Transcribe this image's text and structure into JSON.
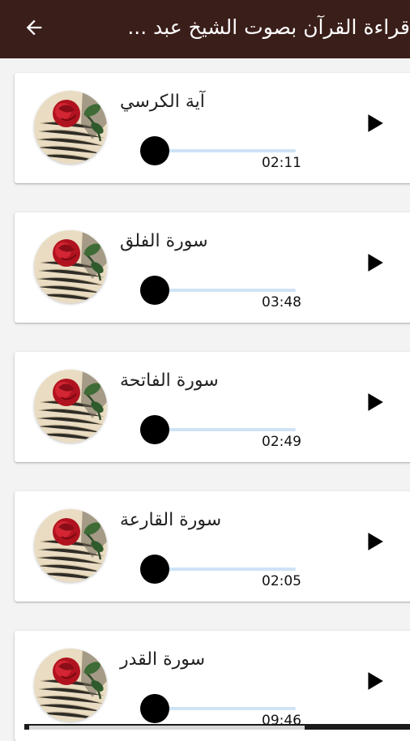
{
  "header": {
    "title": "قراءة القرآن بصوت الشيخ عبد ...",
    "back_icon": "arrow-left-icon",
    "background": "#3a1e19"
  },
  "tracks": [
    {
      "name": "آية الكرسي",
      "duration": "02:11",
      "progress": 0
    },
    {
      "name": "سورة الفلق",
      "duration": "03:48",
      "progress": 0
    },
    {
      "name": "سورة الفاتحة",
      "duration": "02:49",
      "progress": 0
    },
    {
      "name": "سورة القارعة",
      "duration": "02:05",
      "progress": 0
    },
    {
      "name": "سورة القدر",
      "duration": "09:46",
      "progress": 0
    }
  ],
  "icons": {
    "thumbnail": "rose-quran-thumbnail",
    "play": "play-icon"
  }
}
